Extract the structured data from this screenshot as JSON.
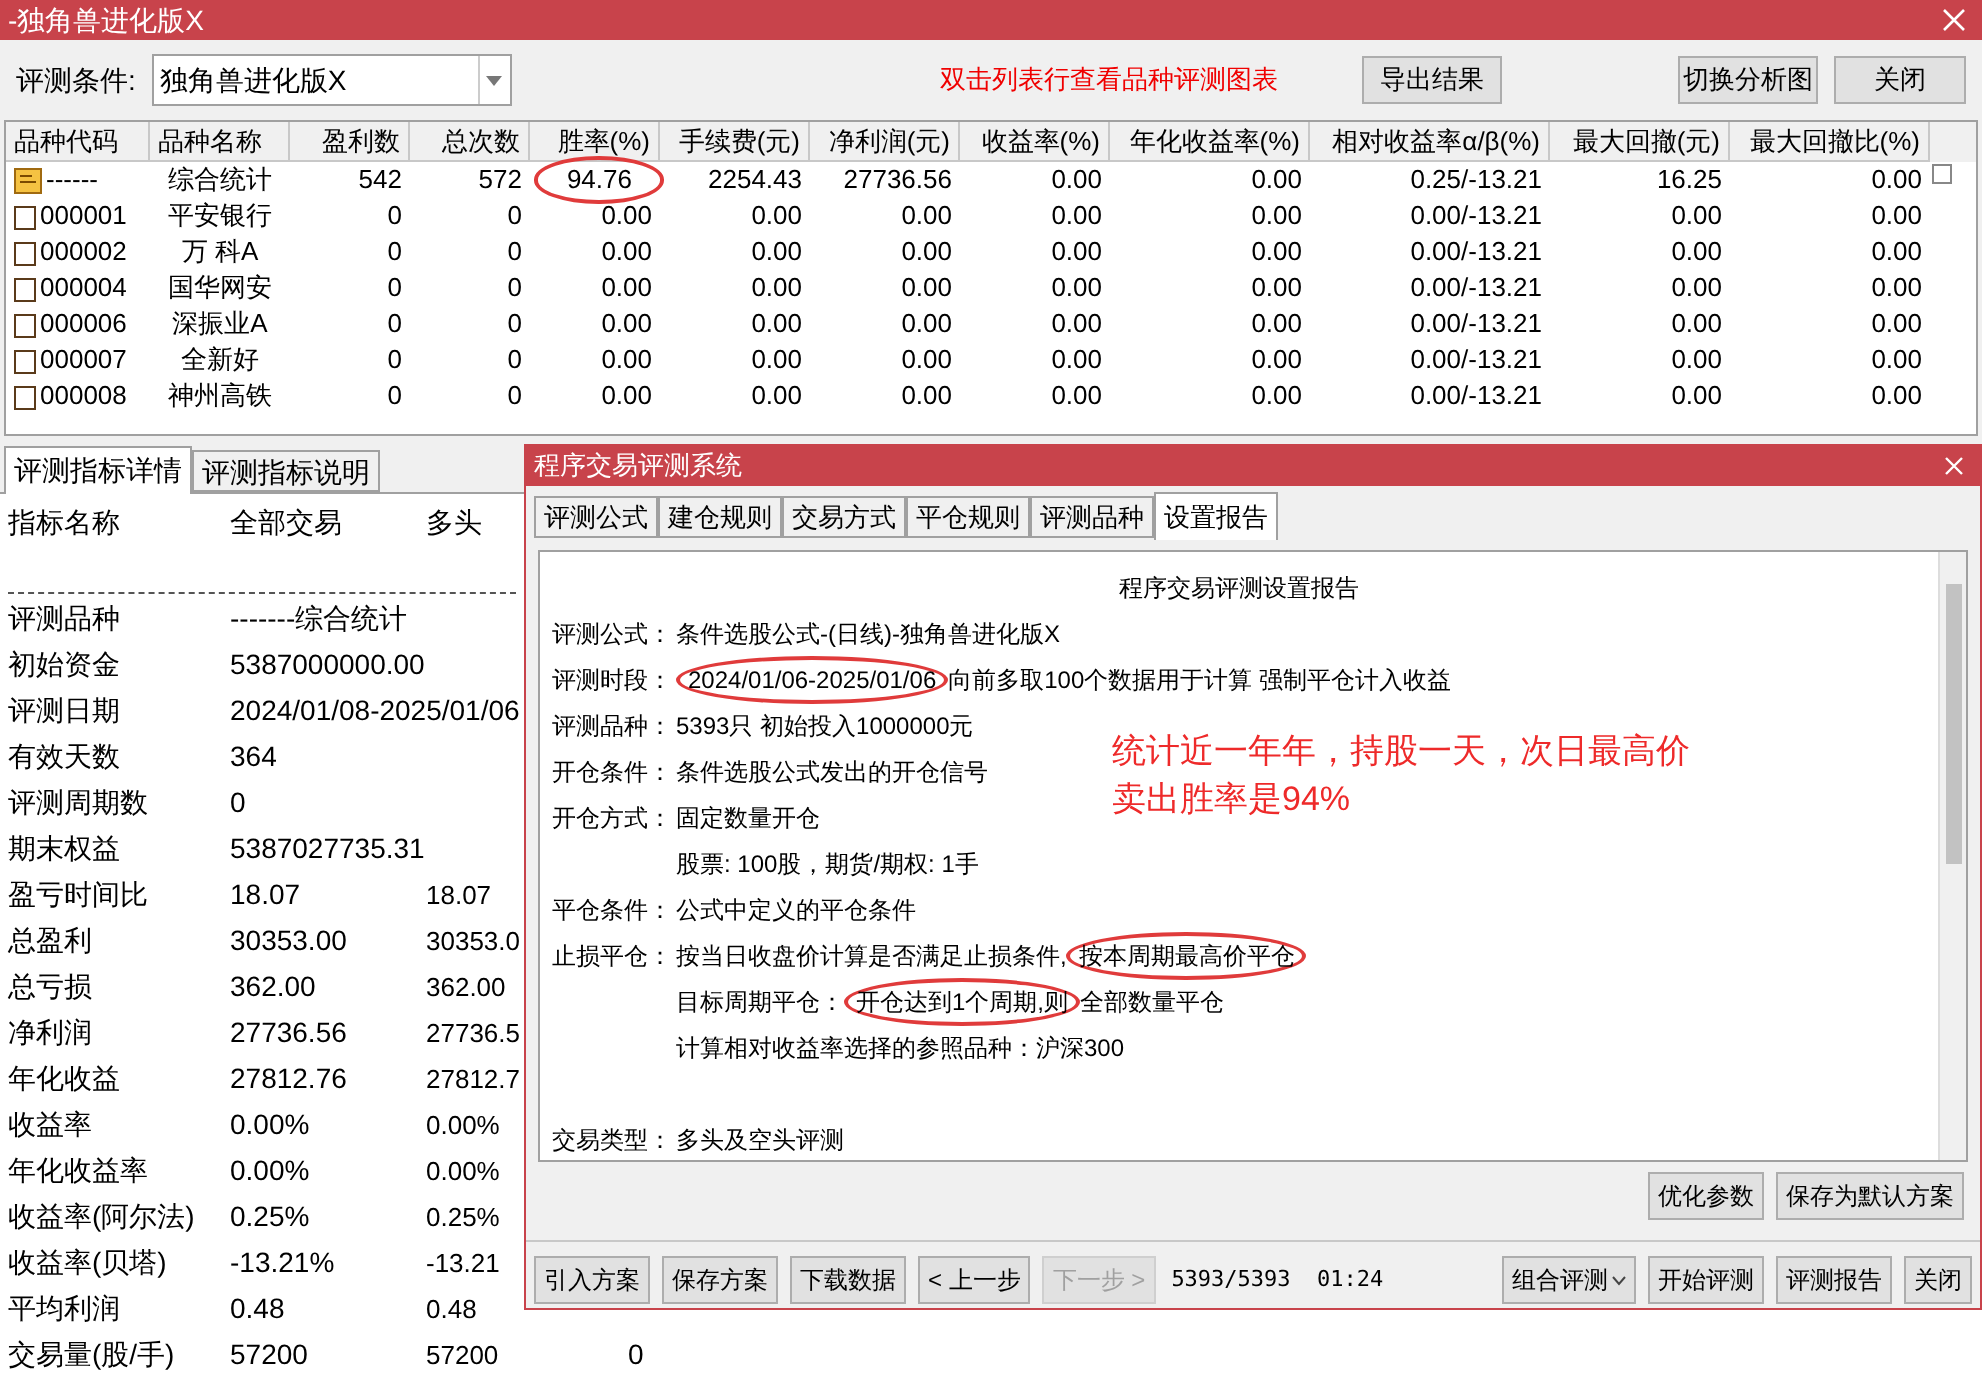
{
  "window": {
    "title": "-独角兽进化版X"
  },
  "toolbar": {
    "condition_label": "评测条件:",
    "condition_value": "独角兽进化版X",
    "hint": "双击列表行查看品种评测图表",
    "buttons": [
      "导出结果",
      "切换分析图",
      "关闭"
    ]
  },
  "table": {
    "select_all_checked": false,
    "columns": [
      "品种代码",
      "品种名称",
      "盈利数",
      "总次数",
      "胜率(%)",
      "手续费(元)",
      "净利润(元)",
      "收益率(%)",
      "年化收益率(%)",
      "相对收益率α/β(%)",
      "最大回撤(元)",
      "最大回撤比(%)"
    ],
    "rows": [
      {
        "kind": "summary",
        "cells": [
          "------",
          "综合统计",
          "542",
          "572",
          {
            "text": "94.76",
            "circled": true
          },
          "2254.43",
          "27736.56",
          "0.00",
          "0.00",
          "0.25/-13.21",
          "16.25",
          "0.00"
        ]
      },
      {
        "kind": "stock",
        "cells": [
          "000001",
          "平安银行",
          "0",
          "0",
          "0.00",
          "0.00",
          "0.00",
          "0.00",
          "0.00",
          "0.00/-13.21",
          "0.00",
          "0.00"
        ]
      },
      {
        "kind": "stock",
        "cells": [
          "000002",
          "万 科A",
          "0",
          "0",
          "0.00",
          "0.00",
          "0.00",
          "0.00",
          "0.00",
          "0.00/-13.21",
          "0.00",
          "0.00"
        ]
      },
      {
        "kind": "stock",
        "cells": [
          "000004",
          "国华网安",
          "0",
          "0",
          "0.00",
          "0.00",
          "0.00",
          "0.00",
          "0.00",
          "0.00/-13.21",
          "0.00",
          "0.00"
        ]
      },
      {
        "kind": "stock",
        "cells": [
          "000006",
          "深振业A",
          "0",
          "0",
          "0.00",
          "0.00",
          "0.00",
          "0.00",
          "0.00",
          "0.00/-13.21",
          "0.00",
          "0.00"
        ]
      },
      {
        "kind": "stock",
        "cells": [
          "000007",
          "全新好",
          "0",
          "0",
          "0.00",
          "0.00",
          "0.00",
          "0.00",
          "0.00",
          "0.00/-13.21",
          "0.00",
          "0.00"
        ]
      },
      {
        "kind": "stock",
        "cells": [
          "000008",
          "神州高铁",
          "0",
          "0",
          "0.00",
          "0.00",
          "0.00",
          "0.00",
          "0.00",
          "0.00/-13.21",
          "0.00",
          "0.00"
        ]
      }
    ]
  },
  "side_panel": {
    "tabs": [
      {
        "label": "评测指标详情",
        "selected": true
      },
      {
        "label": "评测指标说明",
        "selected": false
      }
    ],
    "header": [
      "指标名称",
      "全部交易",
      "多头"
    ],
    "rows": [
      {
        "name": "评测品种",
        "all": "-------综合统计"
      },
      {
        "name": "初始资金",
        "all": "5387000000.00"
      },
      {
        "name": "评测日期",
        "all": "2024/01/08-2025/01/06"
      },
      {
        "name": "有效天数",
        "all": "364"
      },
      {
        "name": "评测周期数",
        "all": "0"
      },
      {
        "name": "期末权益",
        "all": "5387027735.31"
      },
      {
        "name": "盈亏时间比",
        "all": "18.07",
        "long": "18.07"
      },
      {
        "name": "总盈利",
        "all": "30353.00",
        "long": "30353.0"
      },
      {
        "name": "总亏损",
        "all": "362.00",
        "long": "362.00"
      },
      {
        "name": "净利润",
        "all": "27736.56",
        "long": "27736.5"
      },
      {
        "name": "年化收益",
        "all": "27812.76",
        "long": "27812.7"
      },
      {
        "name": "收益率",
        "all": "0.00%",
        "long": "0.00%"
      },
      {
        "name": "年化收益率",
        "all": "0.00%",
        "long": "0.00%"
      },
      {
        "name": "收益率(阿尔法)",
        "all": "0.25%",
        "long": "0.25%"
      },
      {
        "name": "收益率(贝塔)",
        "all": "-13.21%",
        "long": "-13.21"
      },
      {
        "name": "平均利润",
        "all": "0.48",
        "long": "0.48"
      },
      {
        "name": "交易量(股/手)",
        "all": "57200",
        "long": "57200",
        "column_4": "0"
      }
    ]
  },
  "dialog": {
    "title": "程序交易评测系统",
    "tabs": [
      {
        "label": "评测公式",
        "selected": false
      },
      {
        "label": "建仓规则",
        "selected": false
      },
      {
        "label": "交易方式",
        "selected": false
      },
      {
        "label": "平仓规则",
        "selected": false
      },
      {
        "label": "评测品种",
        "selected": false
      },
      {
        "label": "设置报告",
        "selected": true
      }
    ],
    "report": {
      "title": "程序交易评测设置报告",
      "lines": [
        {
          "kind": "field",
          "label": "评测公式：",
          "parts": [
            {
              "text": "条件选股公式-(日线)-独角兽进化版X",
              "circled": false
            }
          ]
        },
        {
          "kind": "field",
          "label": "评测时段：",
          "parts": [
            {
              "text": "2024/01/06-2025/01/06",
              "circled": true
            },
            {
              "text": "向前多取100个数据用于计算 强制平仓计入收益",
              "circled": false
            }
          ]
        },
        {
          "kind": "field",
          "label": "评测品种：",
          "parts": [
            {
              "text": "5393只 初始投入1000000元",
              "circled": false
            }
          ]
        },
        {
          "kind": "field",
          "label": "开仓条件：",
          "parts": [
            {
              "text": "条件选股公式发出的开仓信号",
              "circled": false
            }
          ]
        },
        {
          "kind": "field",
          "label": "开仓方式：",
          "parts": [
            {
              "text": "固定数量开仓",
              "circled": false
            }
          ]
        },
        {
          "kind": "indent",
          "parts": [
            {
              "text": "股票: 100股，期货/期权: 1手",
              "circled": false
            }
          ]
        },
        {
          "kind": "field",
          "label": "平仓条件：",
          "parts": [
            {
              "text": "公式中定义的平仓条件",
              "circled": false
            }
          ]
        },
        {
          "kind": "field",
          "label": "止损平仓：",
          "parts": [
            {
              "text": "按当日收盘价计算是否满足止损条件,",
              "circled": false
            },
            {
              "text": "按本周期最高价平仓",
              "circled": true
            }
          ]
        },
        {
          "kind": "indent",
          "parts": [
            {
              "text": "目标周期平仓：",
              "circled": false
            },
            {
              "text": "开仓达到1个周期,则",
              "circled": true
            },
            {
              "text": "全部数量平仓",
              "circled": false
            }
          ]
        },
        {
          "kind": "indent",
          "parts": [
            {
              "text": "计算相对收益率选择的参照品种：沪深300",
              "circled": false
            }
          ]
        },
        {
          "kind": "gap_field",
          "label": "交易类型：",
          "parts": [
            {
              "text": "多头及空头评测",
              "circled": false
            }
          ]
        }
      ],
      "note": [
        "统计近一年年，持股一天，次日最高价",
        "卖出胜率是94%"
      ]
    },
    "report_buttons": [
      "优化参数",
      "保存为默认方案"
    ],
    "bottom_buttons": [
      {
        "label": "引入方案",
        "disabled": false
      },
      {
        "label": "保存方案",
        "disabled": false
      },
      {
        "label": "下载数据",
        "disabled": false
      },
      {
        "label": "< 上一步",
        "disabled": false
      },
      {
        "label": "下一步 >",
        "disabled": true
      }
    ],
    "status": "5393/5393  01:24",
    "right_buttons": [
      {
        "label": "组合评测",
        "dropdown": true
      },
      {
        "label": "开始评测",
        "dropdown": false
      },
      {
        "label": "评测报告",
        "dropdown": false
      },
      {
        "label": "关闭",
        "dropdown": false
      }
    ]
  }
}
